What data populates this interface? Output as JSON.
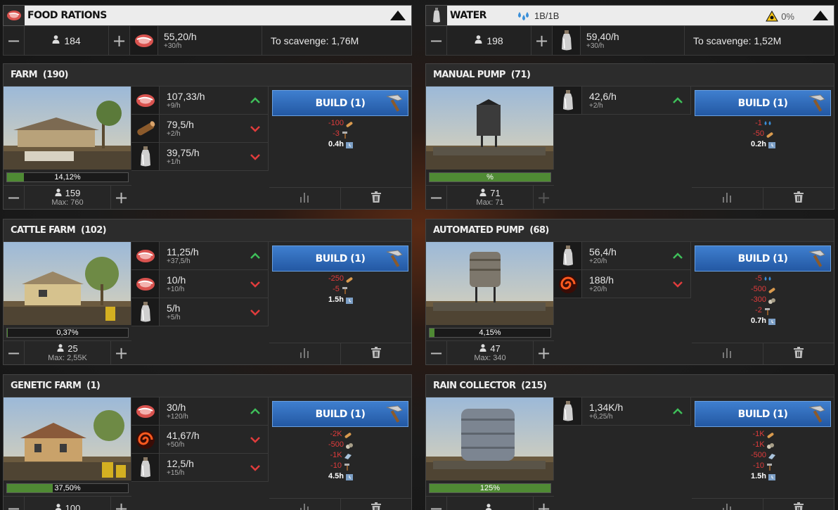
{
  "left": {
    "resource": {
      "title": "FOOD RATIONS",
      "population": "184",
      "rate": "55,20/h",
      "rate_change": "+30/h",
      "scavenge": "To scavenge: 1,76M"
    },
    "buildings": [
      {
        "title": "FARM",
        "count": "(190)",
        "progress_label": "14,12%",
        "progress": 0.1412,
        "workers": "159",
        "max": "Max: 760",
        "products": [
          {
            "icon": "meat-icon",
            "main": "107,33/h",
            "sub": "+9/h",
            "trend": "up"
          },
          {
            "icon": "log-icon",
            "main": "79,5/h",
            "sub": "+2/h",
            "trend": "down"
          },
          {
            "icon": "bottle-icon",
            "main": "39,75/h",
            "sub": "+1/h",
            "trend": "down"
          }
        ],
        "build_label": "BUILD (1)",
        "costs": [
          {
            "text": "-100",
            "icon": "wood-icon",
            "type": "red"
          },
          {
            "text": "-3",
            "icon": "hammer-icon",
            "type": "red"
          }
        ],
        "time": "0.4h"
      },
      {
        "title": "CATTLE FARM",
        "count": "(102)",
        "progress_label": "0,37%",
        "progress": 0.0037,
        "workers": "25",
        "max": "Max: 2,55K",
        "products": [
          {
            "icon": "meat-icon",
            "main": "11,25/h",
            "sub": "+37,5/h",
            "trend": "up"
          },
          {
            "icon": "meat-icon",
            "main": "10/h",
            "sub": "+10/h",
            "trend": "down"
          },
          {
            "icon": "bottle-icon",
            "main": "5/h",
            "sub": "+5/h",
            "trend": "down"
          }
        ],
        "build_label": "BUILD (1)",
        "costs": [
          {
            "text": "-250",
            "icon": "wood-icon",
            "type": "red"
          },
          {
            "text": "-5",
            "icon": "hammer-icon",
            "type": "red"
          }
        ],
        "time": "1.5h"
      },
      {
        "title": "GENETIC FARM",
        "count": "(1)",
        "progress_label": "37,50%",
        "progress": 0.375,
        "workers": "100",
        "max": "",
        "products": [
          {
            "icon": "meat-icon",
            "main": "30/h",
            "sub": "+120/h",
            "trend": "up"
          },
          {
            "icon": "swirl-icon",
            "main": "41,67/h",
            "sub": "+50/h",
            "trend": "down"
          },
          {
            "icon": "bottle-icon",
            "main": "12,5/h",
            "sub": "+15/h",
            "trend": "down"
          }
        ],
        "build_label": "BUILD (1)",
        "costs": [
          {
            "text": "-2K",
            "icon": "wood-icon",
            "type": "red"
          },
          {
            "text": "-500",
            "icon": "stone-icon",
            "type": "red"
          },
          {
            "text": "-1K",
            "icon": "metal-icon",
            "type": "red"
          },
          {
            "text": "-10",
            "icon": "hammer-icon",
            "type": "red"
          }
        ],
        "time": "4.5h"
      }
    ]
  },
  "right": {
    "resource": {
      "title": "WATER",
      "storage": "1B/1B",
      "toxicity": "0%",
      "population": "198",
      "rate": "59,40/h",
      "rate_change": "+30/h",
      "scavenge": "To scavenge: 1,52M"
    },
    "buildings": [
      {
        "title": "MANUAL PUMP",
        "count": "(71)",
        "progress_label": "%",
        "progress": 1.0,
        "workers": "71",
        "max": "Max: 71",
        "plus_disabled": true,
        "products": [
          {
            "icon": "bottle-icon",
            "main": "42,6/h",
            "sub": "+2/h",
            "trend": "up"
          }
        ],
        "build_label": "BUILD (1)",
        "costs": [
          {
            "text": "-1",
            "icon": "water-drops-icon",
            "type": "red"
          },
          {
            "text": "-50",
            "icon": "wood-icon",
            "type": "red"
          }
        ],
        "time": "0.2h"
      },
      {
        "title": "AUTOMATED PUMP",
        "count": "(68)",
        "progress_label": "4,15%",
        "progress": 0.0415,
        "workers": "47",
        "max": "Max: 340",
        "products": [
          {
            "icon": "bottle-icon",
            "main": "56,4/h",
            "sub": "+20/h",
            "trend": "up"
          },
          {
            "icon": "swirl-icon",
            "main": "188/h",
            "sub": "+20/h",
            "trend": "down"
          }
        ],
        "build_label": "BUILD (1)",
        "costs": [
          {
            "text": "-5",
            "icon": "water-drops-icon",
            "type": "red"
          },
          {
            "text": "-500",
            "icon": "wood-icon",
            "type": "red"
          },
          {
            "text": "-300",
            "icon": "stone-icon",
            "type": "red"
          },
          {
            "text": "-2",
            "icon": "hammer-icon",
            "type": "red"
          }
        ],
        "time": "0.7h"
      },
      {
        "title": "RAIN COLLECTOR",
        "count": "(215)",
        "progress_label": "125%",
        "progress": 1.0,
        "workers": "",
        "max": "",
        "products": [
          {
            "icon": "bottle-icon",
            "main": "1,34K/h",
            "sub": "+6,25/h",
            "trend": "up"
          }
        ],
        "build_label": "BUILD (1)",
        "costs": [
          {
            "text": "-1K",
            "icon": "wood-icon",
            "type": "red"
          },
          {
            "text": "-1K",
            "icon": "stone-icon",
            "type": "red"
          },
          {
            "text": "-500",
            "icon": "metal-icon",
            "type": "red"
          },
          {
            "text": "-10",
            "icon": "hammer-icon",
            "type": "red"
          }
        ],
        "time": "1.5h"
      }
    ]
  }
}
